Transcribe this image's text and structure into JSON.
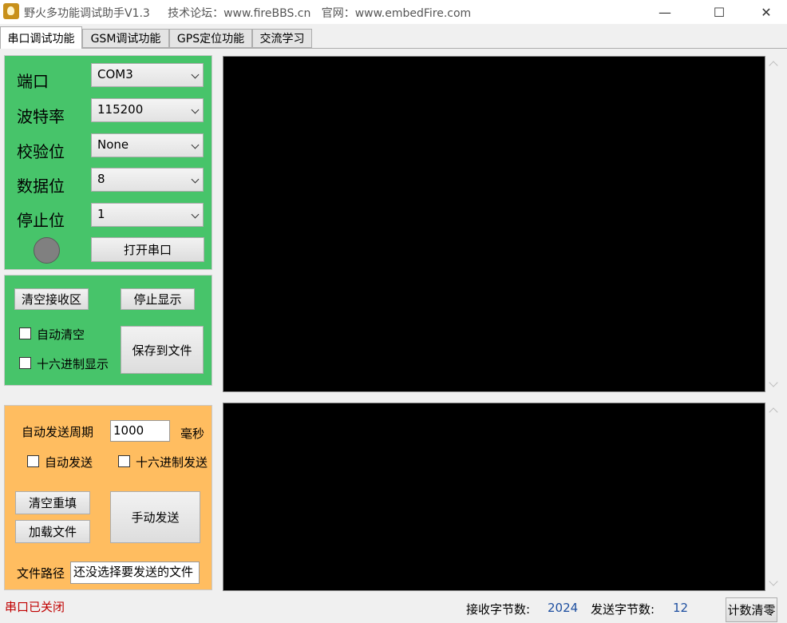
{
  "window": {
    "title": "野火多功能调试助手V1.3     技术论坛：www.fireBBS.cn   官网：www.embedFire.com",
    "minimize": "—",
    "maximize": "☐",
    "close": "✕"
  },
  "tabs": [
    "串口调试功能",
    "GSM调试功能",
    "GPS定位功能",
    "交流学习"
  ],
  "serial": {
    "port_label": "端口",
    "port_value": "COM3",
    "baud_label": "波特率",
    "baud_value": "115200",
    "parity_label": "校验位",
    "parity_value": "None",
    "databits_label": "数据位",
    "databits_value": "8",
    "stopbits_label": "停止位",
    "stopbits_value": "1",
    "open_button": "打开串口",
    "led_color": "#808080"
  },
  "receive": {
    "clear_button": "清空接收区",
    "stop_button": "停止显示",
    "auto_clear_label": "自动清空",
    "auto_clear_checked": false,
    "hex_display_label": "十六进制显示",
    "hex_display_checked": false,
    "save_button": "保存到文件"
  },
  "send": {
    "period_label": "自动发送周期",
    "period_value": "1000",
    "period_unit": "毫秒",
    "auto_send_label": "自动发送",
    "auto_send_checked": false,
    "hex_send_label": "十六进制发送",
    "hex_send_checked": false,
    "clear_refill_button": "清空重填",
    "load_file_button": "加载文件",
    "manual_send_button": "手动发送",
    "file_path_label": "文件路径",
    "file_path_value": "还没选择要发送的文件"
  },
  "status": {
    "port_state": "串口已关闭",
    "rx_label": "接收字节数:",
    "rx_value": "2024",
    "tx_label": "发送字节数:",
    "tx_value": "12",
    "reset_button": "计数清零"
  },
  "colors": {
    "serial_panel": "#47c46a",
    "send_panel": "#ffbd60",
    "status_closed": "#c00000",
    "count_value": "#1e4fa0"
  }
}
